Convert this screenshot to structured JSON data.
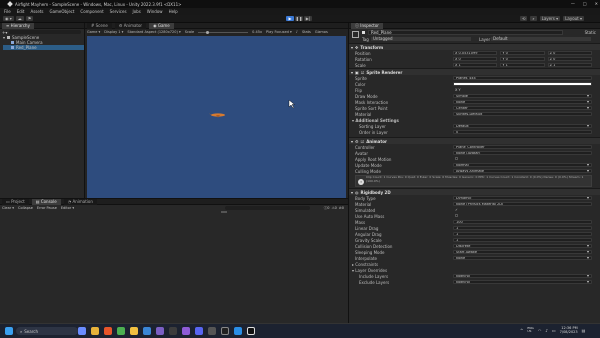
{
  "titlebar": {
    "title": "Airfight Mayhem - SampleScene - Windows, Mac, Linux - Unity 2022.3.9f1 <DX11>",
    "min": "—",
    "max": "□",
    "close": "✕"
  },
  "menu": [
    "File",
    "Edit",
    "Assets",
    "GameObject",
    "Component",
    "Services",
    "Jobs",
    "Window",
    "Help"
  ],
  "toolbar": {
    "layers": "Layers",
    "layout": "Layout"
  },
  "hierarchy": {
    "tab": "Hierarchy",
    "scene": "SampleScene",
    "items": [
      "Main Camera",
      "Red_Plane"
    ]
  },
  "center": {
    "tabs": [
      "Scene",
      "Animator",
      "Game"
    ],
    "game_label": "Game",
    "display": "Display 1",
    "aspect": "Standard Aspect (1280x720)",
    "scale_label": "Scale",
    "scale_value": "0.45x",
    "play_focused": "Play Focused",
    "stats": "Stats",
    "gizmos": "Gizmos"
  },
  "bottom": {
    "tabs": [
      "Project",
      "Console",
      "Animation"
    ],
    "clear": "Clear",
    "collapse": "Collapse",
    "error_pause": "Error Pause",
    "editor": "Editor",
    "counts": [
      "0",
      "0",
      "0"
    ]
  },
  "inspector": {
    "tab": "Inspector",
    "object_name": "Red_Plane",
    "static": "Static",
    "tag_label": "Tag",
    "tag": "Untagged",
    "layer_label": "Layer",
    "layer": "Default",
    "transform": {
      "title": "Transform",
      "position": [
        "X 0.0531099",
        "Y 0",
        "Z 0"
      ],
      "rotation": [
        "X 0",
        "Y 0",
        "Z 0"
      ],
      "scale": [
        "X 1",
        "Y 1",
        "Z 1"
      ],
      "labels": [
        "Position",
        "Rotation",
        "Scale"
      ]
    },
    "sprite_renderer": {
      "title": "Sprite Renderer",
      "props": [
        [
          "Sprite",
          "Planes_4x4"
        ],
        [
          "Color",
          ""
        ],
        [
          "Flip",
          "X  Y"
        ],
        [
          "Draw Mode",
          "Simple"
        ],
        [
          "Mask Interaction",
          "None"
        ],
        [
          "Sprite Sort Point",
          "Center"
        ],
        [
          "Material",
          "Sprites-Default"
        ]
      ],
      "additional": "Additional Settings",
      "sorting_layer": [
        "Sorting Layer",
        "Default"
      ],
      "order": [
        "Order in Layer",
        "0"
      ]
    },
    "animator": {
      "title": "Animator",
      "props": [
        [
          "Controller",
          "Plane_Controller"
        ],
        [
          "Avatar",
          "None (Avatar)"
        ],
        [
          "Apply Root Motion",
          ""
        ],
        [
          "Update Mode",
          "Normal"
        ],
        [
          "Culling Mode",
          "Always Animate"
        ]
      ],
      "info": "Clip Count: 1  Curves Pos: 0 Quat: 0 Euler: 0 Scale: 0 Muscles: 0 Generic: 0 PPtr: 1  Curves Count: 1 Constant: 0 (0.0%) Dense: 0 (0.0%) Stream: 1 (100.0%)"
    },
    "rigidbody": {
      "title": "Rigidbody 2D",
      "props": [
        [
          "Body Type",
          "Dynamic"
        ],
        [
          "Material",
          "None (Physics Material 2D)"
        ],
        [
          "Simulated",
          "✓"
        ],
        [
          "Use Auto Mass",
          ""
        ],
        [
          "Mass",
          "100"
        ],
        [
          "Linear Drag",
          "1"
        ],
        [
          "Angular Drag",
          "1"
        ],
        [
          "Gravity Scale",
          "1"
        ],
        [
          "Collision Detection",
          "Discrete"
        ],
        [
          "Sleeping Mode",
          "Start Awake"
        ],
        [
          "Interpolate",
          "None"
        ]
      ],
      "constraints": "Constraints",
      "layer_overrides": "Layer Overrides",
      "include": [
        "Include Layers",
        "Nothing"
      ],
      "exclude": [
        "Exclude Layers",
        "Nothing"
      ]
    }
  },
  "taskbar": {
    "search": "Search",
    "lang": "ENG\nUS",
    "time": "12:36 PM",
    "date": "7/08/2023"
  },
  "colors": {
    "game_bg": "#2e4c7e",
    "plane": "#d77a2f",
    "accent": "#3a79d6"
  }
}
